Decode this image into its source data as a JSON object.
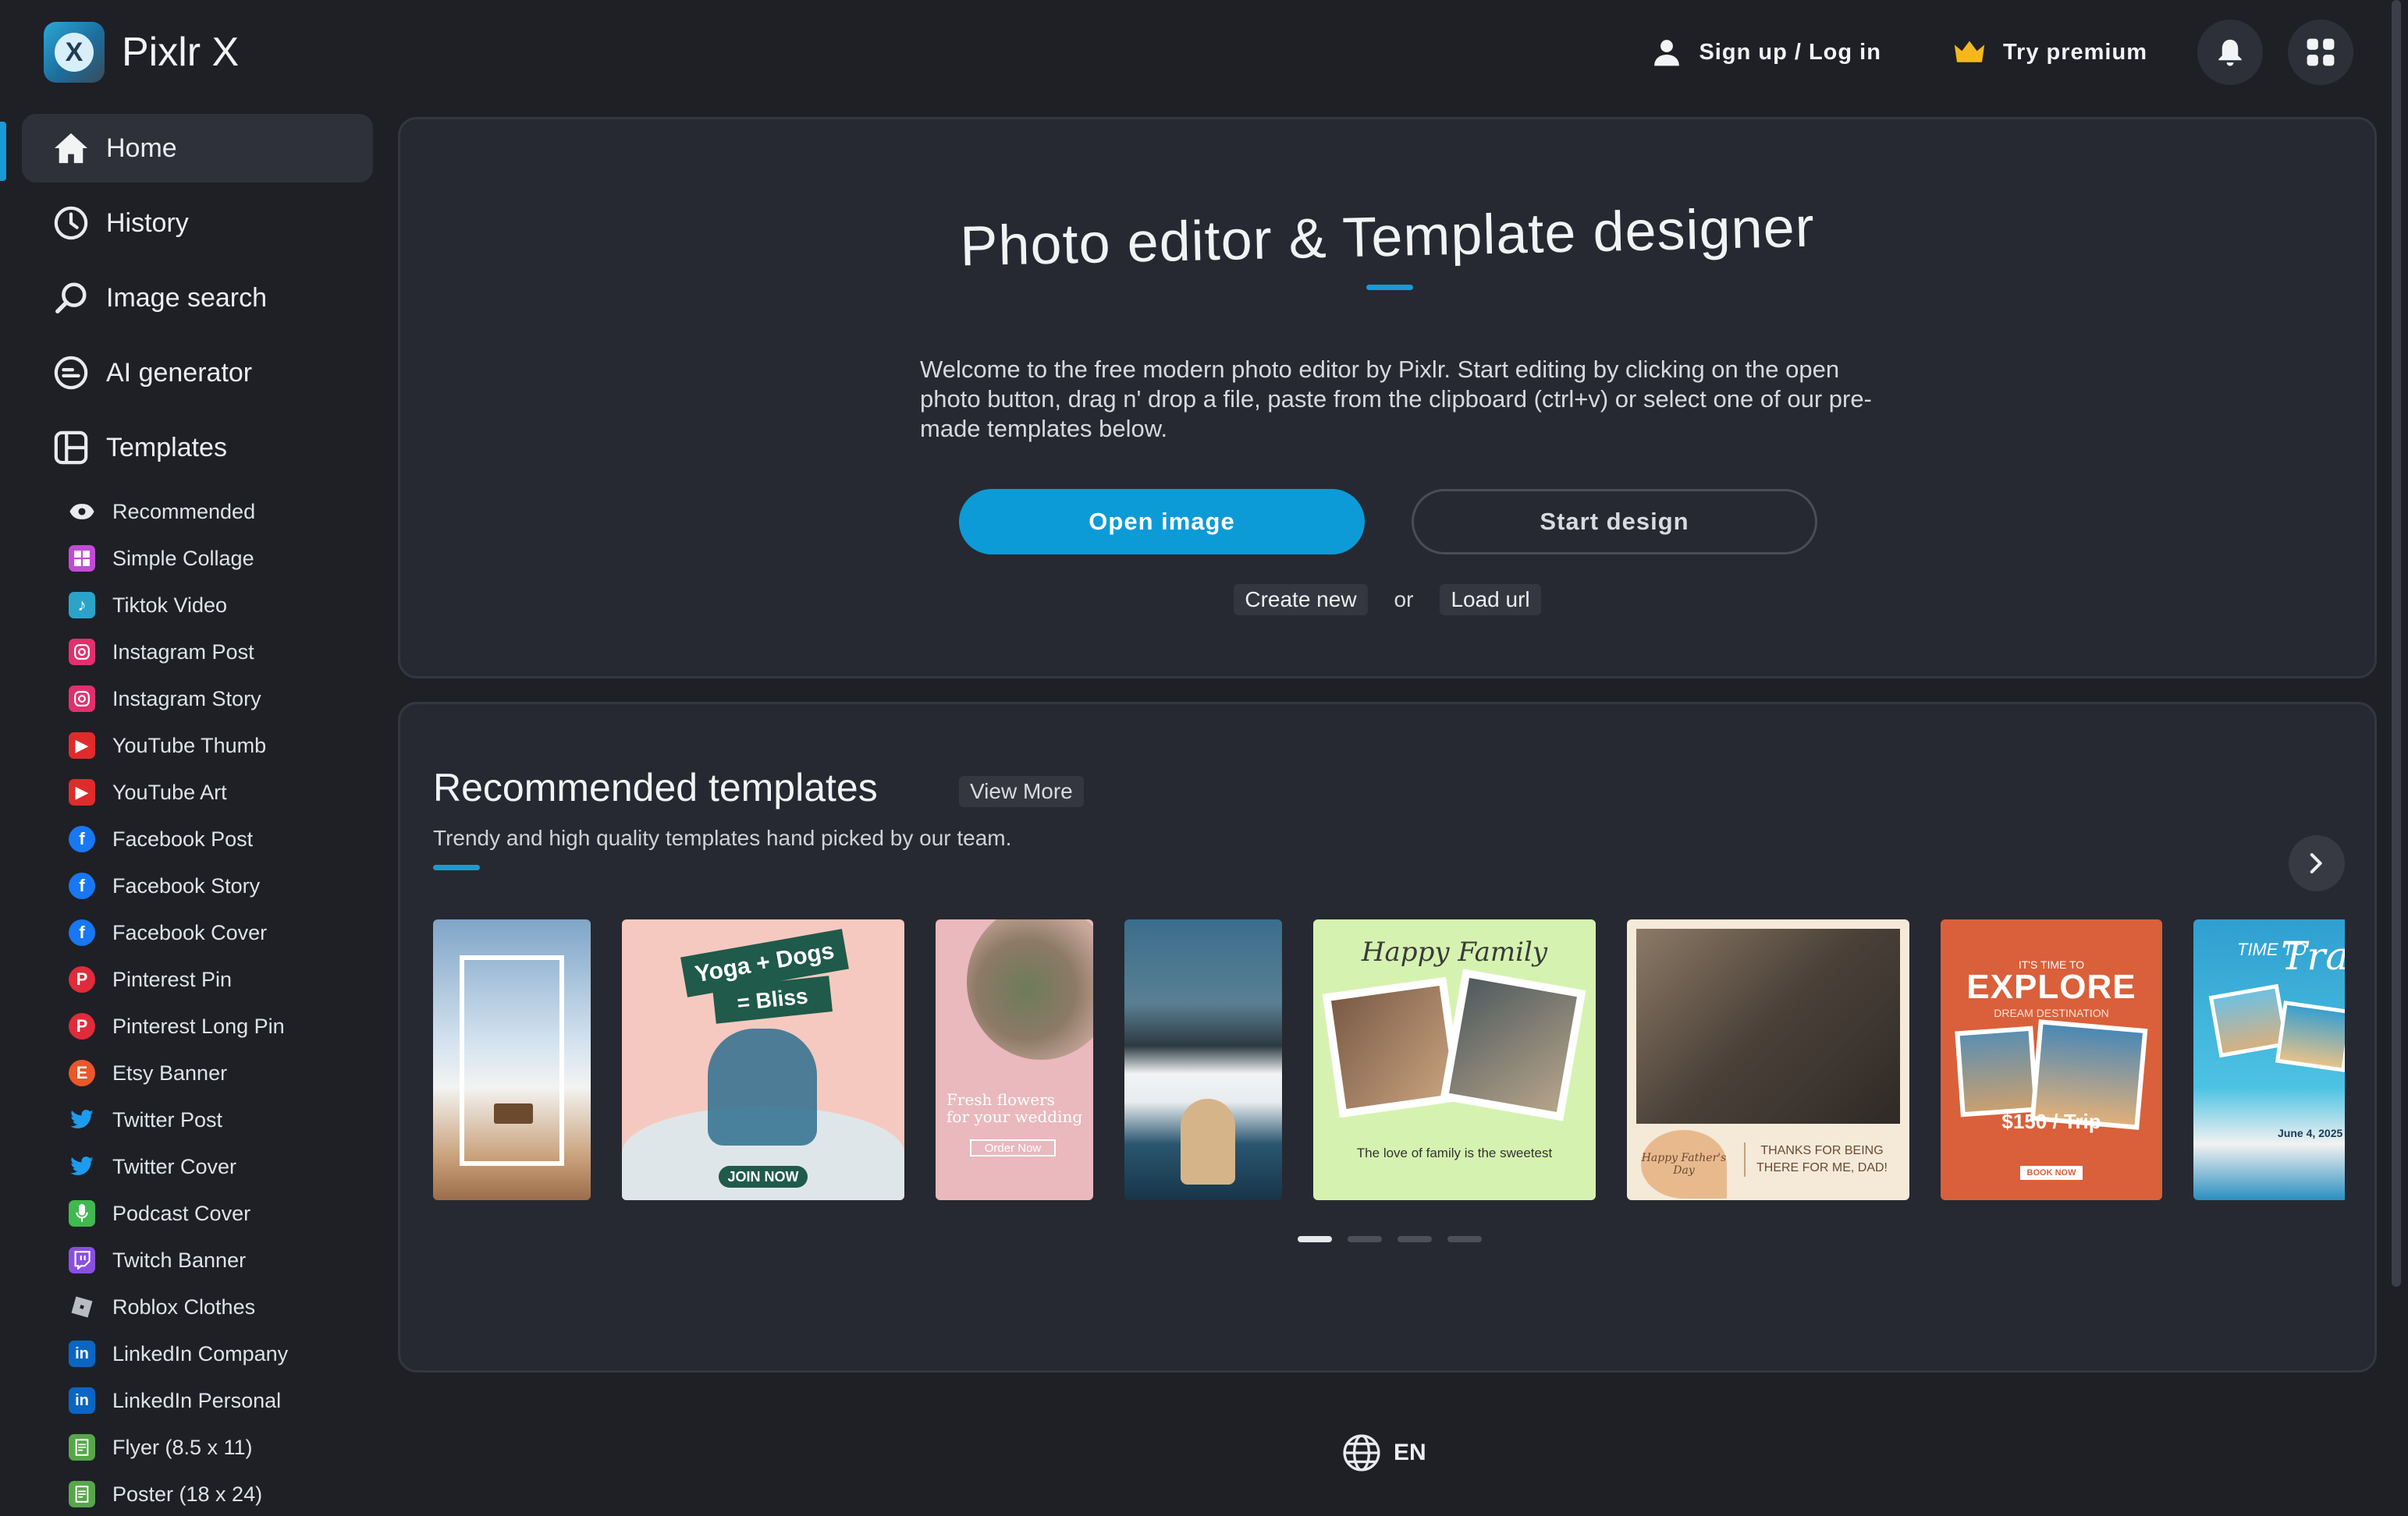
{
  "app": {
    "name": "Pixlr X",
    "logo_letter": "X"
  },
  "header": {
    "signup_label": "Sign up / Log in",
    "premium_label": "Try premium",
    "bell_icon": "bell-icon",
    "apps_icon": "apps-grid-icon"
  },
  "sidebar": {
    "nav": [
      {
        "label": "Home",
        "icon": "home-icon",
        "active": true
      },
      {
        "label": "History",
        "icon": "clock-icon"
      },
      {
        "label": "Image search",
        "icon": "search-icon"
      },
      {
        "label": "AI generator",
        "icon": "ai-icon"
      },
      {
        "label": "Templates",
        "icon": "templates-icon"
      }
    ],
    "templates": [
      {
        "label": "Recommended",
        "icon": "eye-icon",
        "color": "#2b2e35"
      },
      {
        "label": "Simple Collage",
        "icon": "collage-icon",
        "color": "#c24bd6"
      },
      {
        "label": "Tiktok Video",
        "icon": "tiktok-icon",
        "color": "#2ba3c9"
      },
      {
        "label": "Instagram Post",
        "icon": "instagram-icon",
        "color": "#e1306c"
      },
      {
        "label": "Instagram Story",
        "icon": "instagram-icon",
        "color": "#e1306c"
      },
      {
        "label": "YouTube Thumb",
        "icon": "youtube-icon",
        "color": "#e02b2b"
      },
      {
        "label": "YouTube Art",
        "icon": "youtube-icon",
        "color": "#e02b2b"
      },
      {
        "label": "Facebook Post",
        "icon": "facebook-icon",
        "color": "#1877f2"
      },
      {
        "label": "Facebook Story",
        "icon": "facebook-icon",
        "color": "#1877f2"
      },
      {
        "label": "Facebook Cover",
        "icon": "facebook-icon",
        "color": "#1877f2"
      },
      {
        "label": "Pinterest Pin",
        "icon": "pinterest-icon",
        "color": "#e02b3a"
      },
      {
        "label": "Pinterest Long Pin",
        "icon": "pinterest-icon",
        "color": "#e02b3a"
      },
      {
        "label": "Etsy Banner",
        "icon": "etsy-icon",
        "color": "#e9572a"
      },
      {
        "label": "Twitter Post",
        "icon": "twitter-icon",
        "color": "#1d9bf0"
      },
      {
        "label": "Twitter Cover",
        "icon": "twitter-icon",
        "color": "#1d9bf0"
      },
      {
        "label": "Podcast Cover",
        "icon": "podcast-icon",
        "color": "#3fb950"
      },
      {
        "label": "Twitch Banner",
        "icon": "twitch-icon",
        "color": "#8a4fe0"
      },
      {
        "label": "Roblox Clothes",
        "icon": "roblox-icon",
        "color": "#b9bcc2"
      },
      {
        "label": "LinkedIn Company",
        "icon": "linkedin-icon",
        "color": "#0a66c2"
      },
      {
        "label": "LinkedIn Personal",
        "icon": "linkedin-icon",
        "color": "#0a66c2"
      },
      {
        "label": "Flyer (8.5 x 11)",
        "icon": "flyer-icon",
        "color": "#57a64a"
      },
      {
        "label": "Poster (18 x 24)",
        "icon": "poster-icon",
        "color": "#57a64a"
      }
    ]
  },
  "hero": {
    "title": "Photo editor & Template designer",
    "description": "Welcome to the free modern photo editor by Pixlr. Start editing by clicking on the open photo button, drag n' drop a file, paste from the clipboard (ctrl+v) or select one of our pre-made templates below.",
    "open_label": "Open image",
    "start_label": "Start design",
    "create_new_label": "Create new",
    "or_label": "or",
    "load_url_label": "Load url"
  },
  "recommended": {
    "title": "Recommended templates",
    "view_more_label": "View More",
    "subtitle": "Trendy and high quality templates hand picked by our team.",
    "cards": [
      {
        "name": "template-sky-bench",
        "color": "#c9d8e8",
        "texts": []
      },
      {
        "name": "template-yoga-dogs",
        "color": "#f6c9c0",
        "texts": [
          "Yoga + Dogs",
          "= Bliss",
          "JOIN NOW"
        ]
      },
      {
        "name": "template-fresh-flowers",
        "color": "#e9b9bd",
        "texts": [
          "Fresh flowers",
          "for your wedding",
          "Order Now"
        ]
      },
      {
        "name": "template-mountain-clouds",
        "color": "#3a5f78",
        "texts": []
      },
      {
        "name": "template-happy-family",
        "color": "#d6f2b0",
        "texts": [
          "Happy Family",
          "The love of family is the sweetest"
        ]
      },
      {
        "name": "template-fathers-day",
        "color": "#f5ead8",
        "texts": [
          "THANKS FOR BEING THERE FOR ME, DAD!",
          "Happy Father's Day"
        ]
      },
      {
        "name": "template-explore",
        "color": "#d9603a",
        "texts": [
          "IT'S TIME TO",
          "EXPLORE",
          "DREAM DESTINATION",
          "$150 / Trip",
          "BOOK NOW"
        ]
      },
      {
        "name": "template-time-to-travel",
        "color": "#3ab6d8",
        "texts": [
          "TIME TO",
          "Travel",
          "June 4, 2025"
        ]
      }
    ],
    "pagination_count": 4,
    "pagination_active": 0
  },
  "footer": {
    "language": "EN"
  }
}
